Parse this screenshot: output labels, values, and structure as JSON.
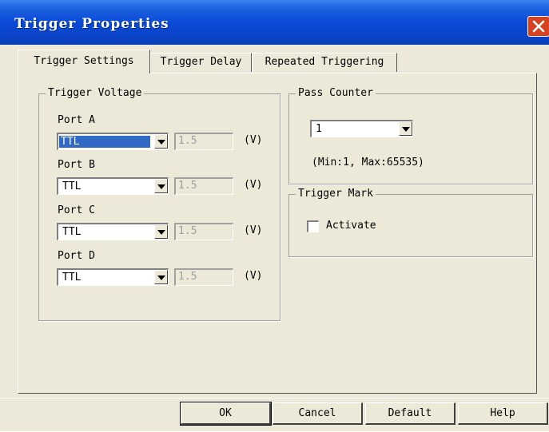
{
  "window": {
    "title": "Trigger Properties"
  },
  "tabs": [
    {
      "label": "Trigger Settings"
    },
    {
      "label": "Trigger Delay"
    },
    {
      "label": "Repeated Triggering"
    }
  ],
  "trigger_voltage": {
    "title": "Trigger Voltage",
    "unit": "(V)",
    "ports": [
      {
        "label": "Port A",
        "mode": "TTL",
        "voltage": "1.5"
      },
      {
        "label": "Port B",
        "mode": "TTL",
        "voltage": "1.5"
      },
      {
        "label": "Port C",
        "mode": "TTL",
        "voltage": "1.5"
      },
      {
        "label": "Port D",
        "mode": "TTL",
        "voltage": "1.5"
      }
    ]
  },
  "pass_counter": {
    "title": "Pass Counter",
    "value": "1",
    "range_hint": "(Min:1, Max:65535)"
  },
  "trigger_mark": {
    "title": "Trigger Mark",
    "activate_label": "Activate",
    "activate_checked": false
  },
  "buttons": {
    "ok": "OK",
    "cancel": "Cancel",
    "default": "Default",
    "help": "Help"
  }
}
